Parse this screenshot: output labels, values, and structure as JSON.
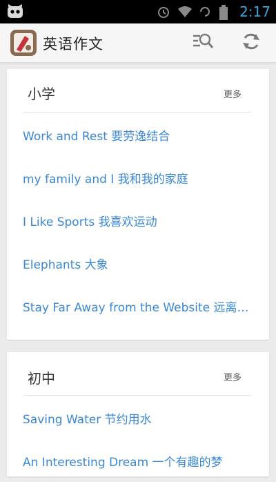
{
  "status_bar": {
    "time": "2:17",
    "icons": [
      "android-cat-icon",
      "alarm-icon",
      "wifi-icon",
      "sync-icon",
      "battery-icon"
    ],
    "accent": "#3aa6e0"
  },
  "app_bar": {
    "title": "英语作文",
    "logo_icon": "app-logo-icon",
    "actions": [
      "search-icon",
      "refresh-icon"
    ],
    "background": "#f6f6f6"
  },
  "sections": [
    {
      "title": "小学",
      "more_label": "更多",
      "items": [
        "Work and Rest 要劳逸结合",
        "my family and  I 我和我的家庭",
        "I Like Sports 我喜欢运动",
        "Elephants 大象",
        "Stay Far Away from the Website 远离网站"
      ]
    },
    {
      "title": "初中",
      "more_label": "更多",
      "items": [
        "Saving Water 节约用水",
        "An Interesting Dream 一个有趣的梦"
      ]
    }
  ],
  "colors": {
    "link": "#3a87d6",
    "page_background": "#ebebeb"
  }
}
